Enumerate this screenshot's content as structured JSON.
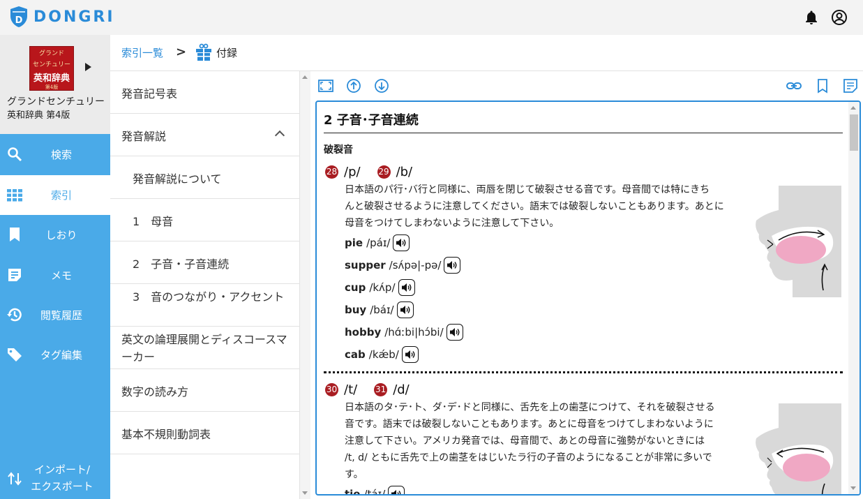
{
  "header": {
    "brand": "DONGRI",
    "icons": [
      "bell-icon",
      "account-circle-icon"
    ]
  },
  "book": {
    "cover": {
      "line1": "グランド",
      "line2": "センチュリー",
      "line3": "英和辞典",
      "edition": "第4版"
    },
    "title_line1": "グランドセンチュリー",
    "title_line2": "英和辞典 第4版"
  },
  "sidebar": {
    "items": [
      {
        "label": "検索",
        "icon": "search-icon"
      },
      {
        "label": "索引",
        "icon": "grid-icon"
      },
      {
        "label": "しおり",
        "icon": "bookmark-icon"
      },
      {
        "label": "メモ",
        "icon": "memo-icon"
      },
      {
        "label": "閲覧履歴",
        "icon": "history-icon"
      },
      {
        "label": "タグ編集",
        "icon": "tag-icon"
      }
    ],
    "export_line1": "インポート/",
    "export_line2": "エクスポート"
  },
  "breadcrumb": {
    "root": "索引一覧",
    "separator": ">",
    "current": "付録"
  },
  "index": {
    "items": [
      {
        "label": "発音記号表"
      },
      {
        "label": "発音解説"
      },
      {
        "label": "発音解説について"
      },
      {
        "label": "1　母音"
      },
      {
        "label": "2　子音・子音連続"
      },
      {
        "label": "3　音のつながり・アクセント"
      },
      {
        "label": "英文の論理展開とディスコースマーカー"
      },
      {
        "label": "数字の読み方"
      },
      {
        "label": "基本不規則動詞表"
      }
    ]
  },
  "content": {
    "title": "2  子音･子音連続",
    "subhead": "破裂音",
    "block1": {
      "num1": "28",
      "sym1": "/p/",
      "num2": "29",
      "sym2": "/b/",
      "lines": [
        "日本語のパ行･バ行と同様に、両唇を閉じて破裂させる音です。母音間では特にきち",
        "んと破裂させるように注意してください。語末では破裂しないこともあります。あとに",
        "母音をつけてしまわないように注意して下さい。"
      ],
      "words": [
        {
          "word": "pie",
          "ipa": "/páɪ/"
        },
        {
          "word": "supper",
          "ipa": "/sʌ́pə|-pə/"
        },
        {
          "word": "cup",
          "ipa": "/kʌ́p/"
        },
        {
          "word": "buy",
          "ipa": "/báɪ/"
        },
        {
          "word": "hobby",
          "ipa": "/hɑ́ːbi|hɔ́bi/"
        },
        {
          "word": "cab",
          "ipa": "/kǽb/"
        }
      ]
    },
    "block2": {
      "num1": "30",
      "sym1": "/t/",
      "num2": "31",
      "sym2": "/d/",
      "lines": [
        "日本語のタ･テ･ト、ダ･デ･ドと同様に、舌先を上の歯茎につけて、それを破裂させる",
        "音です。語末では破裂しないこともあります。あとに母音をつけてしまわないように",
        "注意して下さい。アメリカ発音では、母音間で、あとの母音に強勢がないときには",
        "/t, d/ ともに舌先で上の歯茎をはじいたラ行の子音のようになることが非常に多いで",
        "す。"
      ],
      "words": [
        {
          "word": "tie",
          "ipa": "/táɪ/"
        }
      ]
    }
  },
  "colors": {
    "accent": "#4aaae8",
    "link": "#2a8bd8",
    "number_badge": "#a91d22"
  }
}
